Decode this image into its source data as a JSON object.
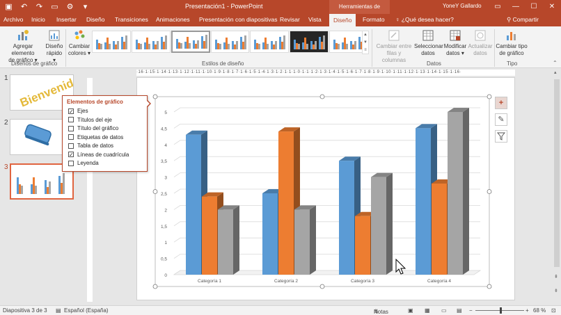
{
  "titlebar": {
    "title": "Presentación1 - PowerPoint",
    "context_tab": "Herramientas de gráficos",
    "user": "YoneY Gallardo"
  },
  "tabs": [
    "Archivo",
    "Inicio",
    "Insertar",
    "Diseño",
    "Transiciones",
    "Animaciones",
    "Presentación con diapositivas",
    "Revisar",
    "Vista",
    "Diseño",
    "Formato"
  ],
  "active_tab": "Diseño",
  "help": "¿Qué desea hacer?",
  "share": "Compartir",
  "ribbon": {
    "add_element_line1": "Agregar elemento",
    "add_element_line2": "de gráfico",
    "quick_layout_line1": "Diseño",
    "quick_layout_line2": "rápido",
    "change_colors_line1": "Cambiar",
    "change_colors_line2": "colores",
    "switch_row_col_line1": "Cambiar entre",
    "switch_row_col_line2": "filas y columnas",
    "select_data_line1": "Seleccionar",
    "select_data_line2": "datos",
    "edit_data_line1": "Modificar",
    "edit_data_line2": "datos",
    "refresh_data_line1": "Actualizar",
    "refresh_data_line2": "datos",
    "change_type_line1": "Cambiar tipo",
    "change_type_line2": "de gráfico",
    "group_layouts": "Diseños de gráfico",
    "group_styles": "Estilos de diseño",
    "group_data": "Datos",
    "group_type": "Tipo"
  },
  "slide_numbers": [
    "1",
    "2",
    "3"
  ],
  "slide1_text": "Bienvenidos",
  "popup": {
    "title": "Elementos de gráfico",
    "items": [
      {
        "label": "Ejes",
        "checked": true
      },
      {
        "label": "Títulos del eje",
        "checked": false
      },
      {
        "label": "Título del gráfico",
        "checked": false
      },
      {
        "label": "Etiquetas de datos",
        "checked": false
      },
      {
        "label": "Tabla de datos",
        "checked": false
      },
      {
        "label": "Líneas de cuadrícula",
        "checked": true
      },
      {
        "label": "Leyenda",
        "checked": false
      }
    ]
  },
  "ruler_text": "·16·1·15·1·14·1·13·1·12·1·11·1·10·1·9·1·8·1·7·1·6·1·5·1·4·1·3·1·2·1·1·1·0·1·1·1·2·1·3·1·4·1·5·1·6·1·7·1·8·1·9·1·10·1·11·1·12·1·13·1·14·1·15·1·16·",
  "colors": {
    "series1": "#5b9bd5",
    "series2": "#ed7d31",
    "series3": "#a5a5a5",
    "accent": "#b7472a"
  },
  "chart_data": {
    "type": "bar",
    "categories": [
      "Categoría 1",
      "Categoría 2",
      "Categoría 3",
      "Categoría 4"
    ],
    "series": [
      {
        "values": [
          4.3,
          2.5,
          3.5,
          4.5
        ]
      },
      {
        "values": [
          2.4,
          4.4,
          1.8,
          2.8
        ]
      },
      {
        "values": [
          2,
          2,
          3,
          5
        ]
      }
    ],
    "yticks": [
      "0",
      "0,5",
      "1",
      "1,5",
      "2",
      "2,5",
      "3",
      "3,5",
      "4",
      "4,5",
      "5"
    ],
    "ylim": [
      0,
      5
    ],
    "grid": true,
    "legend": "none",
    "style": "3-D clustered column"
  },
  "status": {
    "slide_info": "Diapositiva 3 de 3",
    "language": "Español (España)",
    "notes": "Notas",
    "zoom": "68 %",
    "zoom_level": 68
  }
}
